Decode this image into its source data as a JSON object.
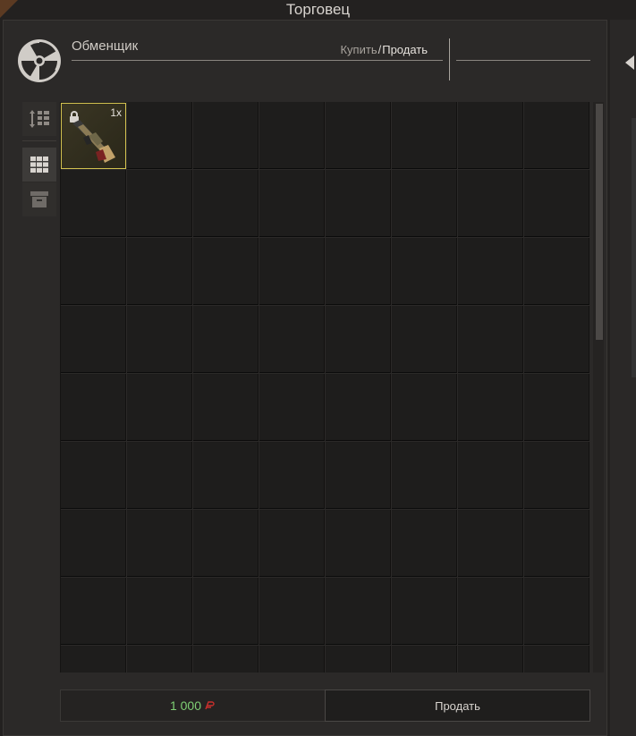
{
  "window": {
    "title": "Торговец"
  },
  "trader": {
    "name": "Обменщик",
    "logo_icon": "radiation-icon"
  },
  "mode": {
    "buy_label": "Купить",
    "separator": "/",
    "sell_label": "Продать"
  },
  "sidebar": {
    "sort_icon": "sort-icon",
    "grid_icon": "grid-icon",
    "box_icon": "box-icon"
  },
  "inventory": {
    "columns": 8,
    "visible_rows": 9,
    "item": {
      "count": "1x",
      "icon": "shotgun-icon",
      "locked": true
    }
  },
  "footer": {
    "money": "1 000",
    "currency_icon": "ruble-icon",
    "sell_button": "Продать"
  },
  "colors": {
    "accent_green": "#7fcf74",
    "selection_yellow": "#d3c250",
    "currency_red": "#c9302c"
  }
}
